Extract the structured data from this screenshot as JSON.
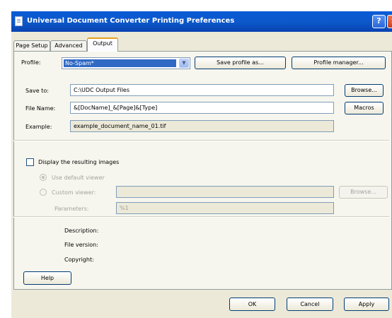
{
  "window": {
    "title": "Universal Document Converter Printing Preferences",
    "help_glyph": "?",
    "close_glyph": "×"
  },
  "tabs": [
    {
      "label": "Page Setup",
      "active": false
    },
    {
      "label": "Advanced",
      "active": false
    },
    {
      "label": "Output",
      "active": true
    }
  ],
  "profile": {
    "label": "Profile:",
    "value": "No-Spam*",
    "save_button": "Save profile as...",
    "manager_button": "Profile manager..."
  },
  "output": {
    "save_to_label": "Save to:",
    "save_to_value": "C:\\UDC Output Files",
    "browse_button": "Browse...",
    "file_name_label": "File Name:",
    "file_name_value": "&[DocName]_&[Page]&[Type]",
    "macros_button": "Macros",
    "example_label": "Example:",
    "example_value": "example_document_name_01.tif"
  },
  "display": {
    "checkbox_label": "Display the resulting images",
    "checked": false,
    "default_viewer_label": "Use default viewer",
    "custom_viewer_label": "Custom viewer:",
    "custom_viewer_value": "",
    "browse_button": "Browse...",
    "parameters_label": "Parameters:",
    "parameters_value": "%1"
  },
  "info": {
    "description_label": "Description:",
    "version_label": "File version:",
    "copyright_label": "Copyright:"
  },
  "buttons": {
    "help": "Help",
    "ok": "OK",
    "cancel": "Cancel",
    "apply": "Apply"
  }
}
